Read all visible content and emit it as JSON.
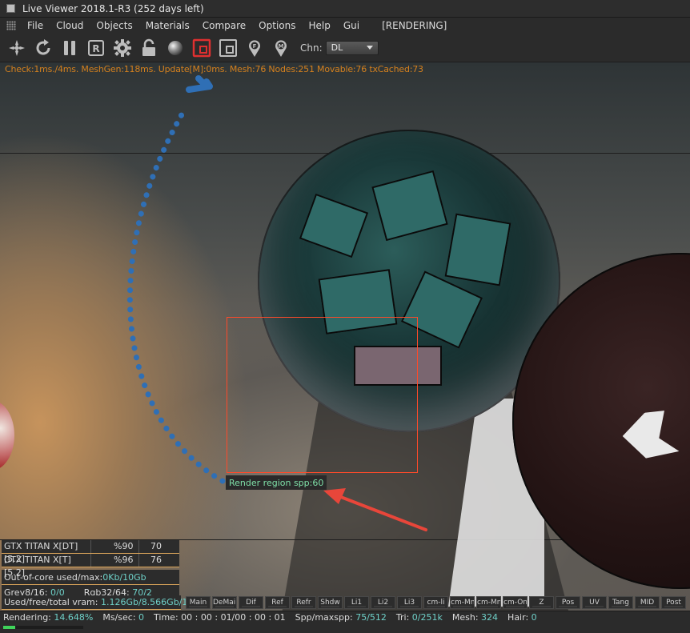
{
  "window": {
    "title": "Live Viewer 2018.1-R3 (252 days left)"
  },
  "menu": {
    "items": [
      "File",
      "Cloud",
      "Objects",
      "Materials",
      "Compare",
      "Options",
      "Help",
      "Gui"
    ],
    "status": "[RENDERING]"
  },
  "toolbar": {
    "buttons": [
      "render-settings-icon",
      "restart-icon",
      "pause-icon",
      "r-icon",
      "gear-icon",
      "lock-icon",
      "material-sphere-icon",
      "render-region-icon",
      "film-region-icon",
      "focus-pin-icon",
      "material-pin-icon"
    ],
    "channel_label": "Chn:",
    "channel_value": "DL"
  },
  "overlay": {
    "stats": "Check:1ms./4ms. MeshGen:118ms. Update[M]:0ms. Mesh:76 Nodes:251 Movable:76 txCached:73"
  },
  "region": {
    "label": "Render region spp:60",
    "color": "#ff4a2a"
  },
  "gpus": [
    {
      "name": "GTX TITAN X[DT][5.2]",
      "load": "%90",
      "temp": "70"
    },
    {
      "name": "GTX TITAN X[T][5.2]",
      "load": "%96",
      "temp": "76"
    }
  ],
  "memory": {
    "out_of_core_label": "Out-of-core used/max:",
    "out_of_core_value": "0Kb/10Gb",
    "grey_label": "Grey8/16:",
    "grey_value": "0/0",
    "rgb_label": "Rgb32/64:",
    "rgb_value": "70/2",
    "vram_label": "Used/free/total vram:",
    "vram_value": "1.126Gb/8.566Gb/12Gb"
  },
  "passes": [
    "Main",
    "DeMain",
    "Dif",
    "Ref",
    "Refr",
    "Shdw",
    "Li1",
    "Li2",
    "Li3",
    "cm-li",
    "cm-Mn",
    "cm-Mn",
    "cm-On",
    "Z",
    "Pos",
    "UV",
    "Tang",
    "MID",
    "Post"
  ],
  "status": {
    "rendering_label": "Rendering:",
    "rendering_value": "14.648%",
    "mssec_label": "Ms/sec:",
    "mssec_value": "0",
    "time_label": "Time:",
    "time_value": "00 : 00 : 01/00 : 00 : 01",
    "spp_label": "Spp/maxspp:",
    "spp_value": "75/512",
    "tri_label": "Tri:",
    "tri_value": "0/251k",
    "mesh_label": "Mesh:",
    "mesh_value": "324",
    "hair_label": "Hair:",
    "hair_value": "0",
    "progress": 0.14648
  },
  "colors": {
    "accent_value": "#6ed0c8",
    "stats_text": "#d4801e",
    "annotation_arrow_blue": "#2f6fb5",
    "annotation_arrow_red": "#e8463a"
  }
}
